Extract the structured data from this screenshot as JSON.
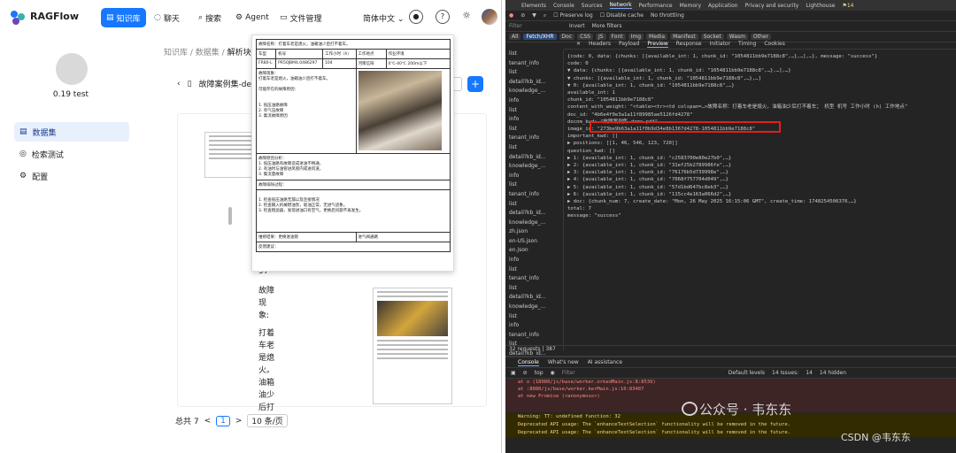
{
  "app": {
    "logo_text": "RAGFlow",
    "nav": [
      "知识库",
      "聊天",
      "搜索",
      "Agent",
      "文件管理"
    ],
    "language": "简体中文",
    "user_name": "0.19 test",
    "sidebar": [
      "数据集",
      "检索测试",
      "配置"
    ],
    "breadcrumb": [
      "知识库",
      "数据集",
      "解析块"
    ],
    "doc_title": "故障案例集-de",
    "vertical_text": [
      "97",
      "故障",
      "现象:",
      "打着",
      "车老",
      "是熄",
      "火。",
      "油箱",
      "油少",
      "后打"
    ],
    "pager": {
      "total": "总共 7",
      "prev": "<",
      "current": "1",
      "next": ">",
      "size": "10 条/页"
    },
    "popup": {
      "title": "故障名称：打着车老是熄火，油箱油少后打不着车。",
      "headers": [
        "车型",
        "机号",
        "工作小时（h）",
        "工作地点",
        "作业环境"
      ],
      "row1": [
        "FR80-L",
        "PR50JBM4,0486297",
        "104",
        "河南信阳",
        "0℃-40℃ 200m以下"
      ],
      "s_phen": "故障现象：",
      "phen_text": "打着车老是熄火，油箱油少后打不着车。",
      "s_reason": "可能存在的故障原因：",
      "reasons": [
        "1. 低压油路故障",
        "2. 有气压故障",
        "3. 集流故障原因"
      ],
      "s_analysis": "故障原因分析：",
      "analysis": [
        "1. 低压油路有故障造成进油不畅通，",
        "2. 有油时与油管进风管内或进风道，",
        "3. 集流量故障"
      ],
      "s_process": "故障排除过程：",
      "process": [
        "1. 检查低压油路无漏以及连接情况",
        "2. 检查输入机械燃油泵，吸油正常，无进气迹象。",
        "3. 检查粗滤器，发现进油口有空气，更换后问题不再发生。"
      ],
      "summary": "维修结果：更换进油管",
      "attach": "反馈建议：",
      "suggest": "进气阀通路"
    }
  },
  "devtools": {
    "top_tabs": [
      "Elements",
      "Console",
      "Sources",
      "Network",
      "Performance",
      "Memory",
      "Application",
      "Privacy and security",
      "Lighthouse"
    ],
    "badge": "14",
    "toolbar": [
      "Preserve log",
      "Disable cache",
      "No throttling"
    ],
    "filter": [
      "Invert",
      "More filters",
      "All",
      "Fetch/XHR",
      "Doc",
      "CSS",
      "JS",
      "Font",
      "Img",
      "Media",
      "Manifest",
      "Socket",
      "Wasm",
      "Other"
    ],
    "detail_tabs": [
      "Name",
      "Headers",
      "Payload",
      "Preview",
      "Response",
      "Initiator",
      "Timing",
      "Cookies"
    ],
    "requests": [
      "list",
      "tenant_info",
      "list",
      "detail?kb_id...",
      "knowledge_...",
      "info",
      "list",
      "info",
      "list",
      "tenant_info",
      "list",
      "detail?kb_id...",
      "knowledge_...",
      "info",
      "list",
      "tenant_info",
      "list",
      "detail?kb_id...",
      "knowledge_...",
      "zh.json",
      "en-US.json",
      "en.json",
      "info",
      "list",
      "tenant_info",
      "list",
      "detail?kb_id...",
      "knowledge_...",
      "list",
      "info",
      "tenant_info",
      "list",
      "detail?kb_id...",
      "knowledge_...",
      "info",
      "list"
    ],
    "preview": [
      "{code: 0, data: {chunks: [{available_int: 1, chunk_id: \"1054811bb9e7188c8\",…},…],…}, message: \"success\"}",
      "  code: 0",
      "▼ data: {chunks: [{available_int: 1, chunk_id: \"1054811bb9e7188c8\",…},…],…}",
      "  ▼ chunks: [{available_int: 1, chunk_id: \"1054811bb9e7188c8\",…},…]",
      "    ▼ 0: {available_int: 1, chunk_id: \"1054811bb9e7188c8\",…}",
      "        available_int: 1",
      "        chunk_id: \"1054811bb9e7188c8\"",
      "        content_with_weight: \"<table><tr><td colspan=…>故障名称：打着车老是熄火，油箱油少后打不着车；  机型  机号  工作小时 (h)  工作地点\"",
      "        doc_id: \"4b6e4f0e3a1a11f89985ae5126fd4278\"",
      "        docnm_kwd: \"故障案例集-demo.pdf\"",
      "        image_id: \"273be9b63a1a11f0b9d34e8b1367d4278-1054811bb9e7188c8\"",
      "        important_kwd: []",
      "      ▶ positions: [[1, 46, 546, 123, 720]]",
      "        question_kwd: []",
      "    ▶ 1: {available_int: 1, chunk_id: \"c2583700e80e27b0\",…}",
      "    ▶ 2: {available_int: 1, chunk_id: \"31ef25b2789986fe\",…}",
      "    ▶ 3: {available_int: 1, chunk_id: \"76176b5d739998e\",…}",
      "    ▶ 4: {available_int: 1, chunk_id: \"7068f757704d049\",…}",
      "    ▶ 5: {available_int: 1, chunk_id: \"57d1bd647bc8eb3\",…}",
      "    ▶ 6: {available_int: 1, chunk_id: \"115cc4e163a066d2\",…}",
      "  ▶ doc: {chunk_num: 7, create_date: \"Mon, 26 May 2025 16:15:06 GMT\", create_time: 1748254506376,…}",
      "    total: 7",
      "  message: \"success\""
    ],
    "footer": [
      "32 requests",
      "387"
    ],
    "console_tabs": [
      "Console",
      "What's new",
      "AI assistance"
    ],
    "console_bar": [
      "top",
      "Filter",
      "Default levels",
      "14 Issues:",
      "14",
      "14 hidden"
    ],
    "errors": [
      "at o (18080/js/base/worker.orkedMain.js:8:8539)",
      "at :8080/js/base/worker.kerMain.js:10:83487",
      "at new Promise (<anonymous>)"
    ],
    "warnings": [
      "Warning: TT: undefined function: 32",
      "Deprecated API usage: The `enhanceTextSelection` functionality will be removed in the future.",
      "Deprecated API usage: The `enhanceTextSelection` functionality will be removed in the future."
    ]
  },
  "watermark": {
    "line1": "公众号 · 韦东东",
    "line2": "CSDN @韦东东"
  }
}
